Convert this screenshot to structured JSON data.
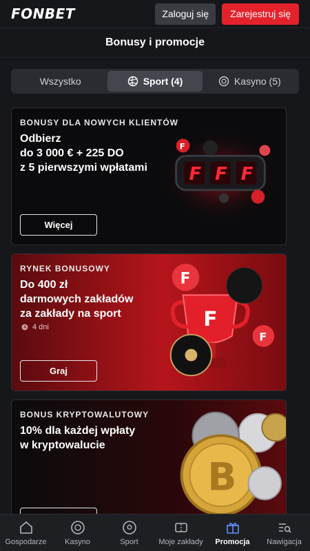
{
  "header": {
    "logo": "FONBET",
    "login_label": "Zaloguj się",
    "register_label": "Zarejestruj się"
  },
  "page": {
    "title": "Bonusy i promocje"
  },
  "tabs": [
    {
      "label": "Wszystko",
      "icon": "none",
      "active": false
    },
    {
      "label": "Sport (4)",
      "icon": "volleyball-icon",
      "active": true
    },
    {
      "label": "Kasyno (5)",
      "icon": "casino-chip-icon",
      "active": false
    }
  ],
  "promos": [
    {
      "category": "BONUSY DLA NOWYCH KLIENTÓW",
      "text_lines": [
        "Odbierz",
        "do 3 000 € + 225 DO",
        "z 5 pierwszymi wpłatami"
      ],
      "button": "Więcej",
      "art": "slot-reels-art"
    },
    {
      "category": "RYNEK BONUSOWY",
      "text_lines": [
        "Do 400 zł",
        "darmowych zakładów",
        "za zakłady na sport"
      ],
      "meta": "4 dni",
      "button": "Graj",
      "art": "trophy-and-balls-art"
    },
    {
      "category": "BONUS KRYPTOWALUTOWY",
      "text_lines": [
        "10% dla każdej wpłaty",
        "w kryptowalucie"
      ],
      "button": "",
      "art": "bitcoin-coins-art"
    }
  ],
  "bottom_nav": [
    {
      "label": "Gospodarze",
      "icon": "home-icon",
      "active": false
    },
    {
      "label": "Kasyno",
      "icon": "casino-chip-icon",
      "active": false
    },
    {
      "label": "Sport",
      "icon": "soccer-ball-icon",
      "active": false
    },
    {
      "label": "Moje zakłady",
      "icon": "ticket-icon",
      "active": false
    },
    {
      "label": "Promocja",
      "icon": "gift-icon",
      "active": true
    },
    {
      "label": "Nawigacja",
      "icon": "menu-search-icon",
      "active": false
    }
  ],
  "colors": {
    "accent_red": "#e4222b",
    "active_nav": "#5f8fff"
  }
}
